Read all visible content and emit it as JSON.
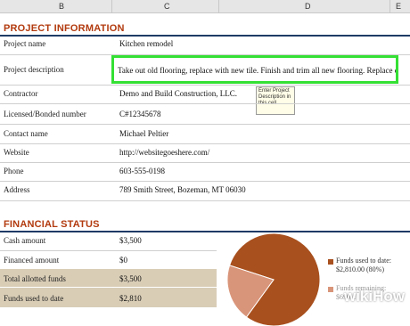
{
  "columns": [
    "B",
    "C",
    "D",
    "E"
  ],
  "project": {
    "heading": "PROJECT INFORMATION",
    "rows": [
      {
        "label": "Project name",
        "value": "Kitchen remodel"
      },
      {
        "label": "Project description",
        "value": "Take out old flooring, replace with new tile. Finish and trim all new flooring. Replace current cal"
      },
      {
        "label": "Contractor",
        "value": "Demo and Build Construction, LLC."
      },
      {
        "label": "Licensed/Bonded number",
        "value": "C#12345678"
      },
      {
        "label": "Contact name",
        "value": "Michael Peltier"
      },
      {
        "label": "Website",
        "value": "http://websitegoeshere.com/"
      },
      {
        "label": "Phone",
        "value": "603-555-0198"
      },
      {
        "label": "Address",
        "value": "789 Smith Street, Bozeman, MT 06030"
      }
    ],
    "tooltip": "Enter Project Description in this cell"
  },
  "financial": {
    "heading": "FINANCIAL STATUS",
    "rows": [
      {
        "label": "Cash amount",
        "value": "$3,500"
      },
      {
        "label": "Financed amount",
        "value": "$0"
      },
      {
        "label": "Total allotted funds",
        "value": "$3,500"
      },
      {
        "label": "Funds used to date",
        "value": "$2,810"
      }
    ]
  },
  "chart_data": {
    "type": "pie",
    "values": [
      80,
      20
    ],
    "colors": [
      "#a8501e",
      "#d9957a"
    ],
    "legend": [
      {
        "line1": "Funds used to date:",
        "line2": "$2,810.00 (80%)"
      },
      {
        "line1": "Funds remaining:",
        "line2": "$690..."
      }
    ]
  },
  "watermark": "wikiHow"
}
